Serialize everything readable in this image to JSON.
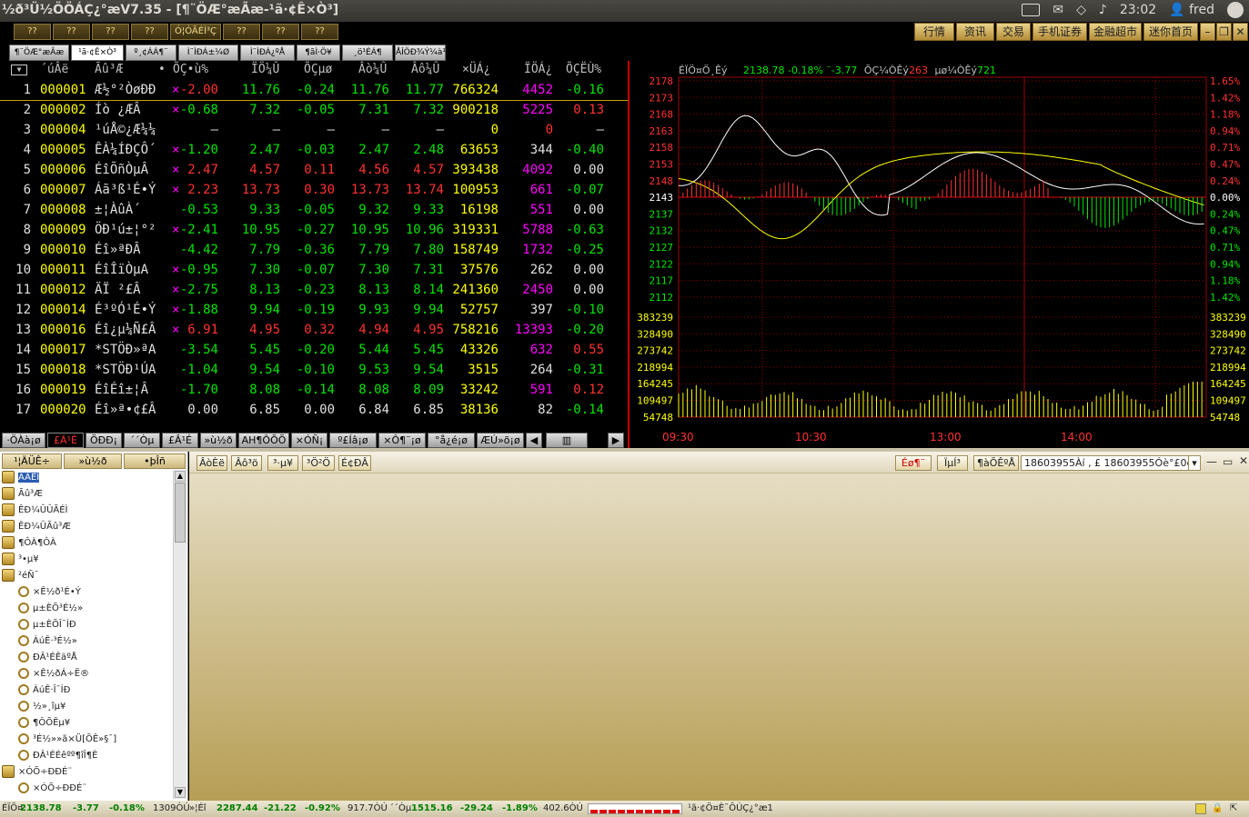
{
  "window": {
    "title": "½ð³Ü½ÖÖÁÇ¿°æV7.35 - [¶¨ÖÆ°æÃæ-¹ã·¢Ê×Ò³]",
    "time": "23:02",
    "user": "fred"
  },
  "top_buttons": [
    "??",
    "??",
    "??",
    "??",
    "Ó¦ÓÃÉÌ³Ç",
    "??",
    "??",
    "??"
  ],
  "right_buttons": [
    "行情",
    "资讯",
    "交易",
    "手机证券",
    "金融超市",
    "迷你首页"
  ],
  "tabs": [
    "¶¨ÖÆ°æÃæ",
    "¹ã·¢Ê×Ò³",
    "º¸¢ÁÁ¶¨",
    "Ì¨ÌÐÁ±¼Ø",
    "Ì¨ÌÐÁ¿ºÅ",
    "¶ãÌ·Ö¥",
    "¸ö¹ÉÁ¶",
    "ÅÎÖÐ¾Ý¼à¹Ü"
  ],
  "grid": {
    "headers": [
      "´úÂë",
      "Ãû³Æ",
      "•",
      "ÕÇ•ù%",
      "ÏÖ¼Û",
      "ÕÇµø",
      "Âò¼Û",
      "Âô¼Û",
      "×ÜÁ¿",
      "ÏÖÁ¿",
      "ÕÇËÙ%"
    ],
    "rows": [
      {
        "n": "1",
        "code": "000001",
        "name": "Æ½°²ÒøÐÐ",
        "mark": "×",
        "pct": "-2.00",
        "price": "11.76",
        "chg": "-0.24",
        "buy": "11.76",
        "sell": "11.77",
        "vol": "766324",
        "cur": "4452",
        "speed": "-0.16",
        "pc": "red",
        "cc": "purple",
        "sc": "green",
        "prc": "green"
      },
      {
        "n": "2",
        "code": "000002",
        "name": "Íò ¿ÆÂ",
        "mark": "×",
        "pct": "-0.68",
        "price": "7.32",
        "chg": "-0.05",
        "buy": "7.31",
        "sell": "7.32",
        "vol": "900218",
        "cur": "5225",
        "speed": "0.13",
        "pc": "green",
        "cc": "purple",
        "sc": "red",
        "prc": "green"
      },
      {
        "n": "3",
        "code": "000004",
        "name": "¹úÅ©¿Æ¼¼",
        "mark": "",
        "pct": "—",
        "price": "—",
        "chg": "—",
        "buy": "—",
        "sell": "—",
        "vol": "0",
        "cur": "0",
        "speed": "—",
        "pc": "white",
        "cc": "red",
        "sc": "white",
        "prc": "white"
      },
      {
        "n": "4",
        "code": "000005",
        "name": "ÊÀ¼ÍÐÇÔ´",
        "mark": "×",
        "pct": "-1.20",
        "price": "2.47",
        "chg": "-0.03",
        "buy": "2.47",
        "sell": "2.48",
        "vol": "63653",
        "cur": "344",
        "speed": "-0.40",
        "pc": "green",
        "cc": "white",
        "sc": "green",
        "prc": "green"
      },
      {
        "n": "5",
        "code": "000006",
        "name": "ÉîÕñÒµÂ",
        "mark": "×",
        "pct": "2.47",
        "price": "4.57",
        "chg": "0.11",
        "buy": "4.56",
        "sell": "4.57",
        "vol": "393438",
        "cur": "4092",
        "speed": "0.00",
        "pc": "red",
        "cc": "purple",
        "sc": "white",
        "prc": "red"
      },
      {
        "n": "6",
        "code": "000007",
        "name": "Áã³ß¹É•Ý",
        "mark": "×",
        "pct": "2.23",
        "price": "13.73",
        "chg": "0.30",
        "buy": "13.73",
        "sell": "13.74",
        "vol": "100953",
        "cur": "661",
        "speed": "-0.07",
        "pc": "red",
        "cc": "purple",
        "sc": "green",
        "prc": "red"
      },
      {
        "n": "7",
        "code": "000008",
        "name": "±¦ÀûÀ´",
        "mark": "",
        "pct": "-0.53",
        "price": "9.33",
        "chg": "-0.05",
        "buy": "9.32",
        "sell": "9.33",
        "vol": "16198",
        "cur": "551",
        "speed": "0.00",
        "pc": "green",
        "cc": "purple",
        "sc": "white",
        "prc": "green"
      },
      {
        "n": "8",
        "code": "000009",
        "name": "ÖÐ¹ú±¦°²",
        "mark": "×",
        "pct": "-2.41",
        "price": "10.95",
        "chg": "-0.27",
        "buy": "10.95",
        "sell": "10.96",
        "vol": "319331",
        "cur": "5788",
        "speed": "-0.63",
        "pc": "green",
        "cc": "purple",
        "sc": "green",
        "prc": "green"
      },
      {
        "n": "9",
        "code": "000010",
        "name": "Éî»ªÐÂ",
        "mark": "",
        "pct": "-4.42",
        "price": "7.79",
        "chg": "-0.36",
        "buy": "7.79",
        "sell": "7.80",
        "vol": "158749",
        "cur": "1732",
        "speed": "-0.25",
        "pc": "green",
        "cc": "purple",
        "sc": "green",
        "prc": "green"
      },
      {
        "n": "10",
        "code": "000011",
        "name": "ÉîÎïÒµA",
        "mark": "×",
        "pct": "-0.95",
        "price": "7.30",
        "chg": "-0.07",
        "buy": "7.30",
        "sell": "7.31",
        "vol": "37576",
        "cur": "262",
        "speed": "0.00",
        "pc": "green",
        "cc": "white",
        "sc": "white",
        "prc": "green"
      },
      {
        "n": "11",
        "code": "000012",
        "name": "ÄÏ ²£Â",
        "mark": "×",
        "pct": "-2.75",
        "price": "8.13",
        "chg": "-0.23",
        "buy": "8.13",
        "sell": "8.14",
        "vol": "241360",
        "cur": "2450",
        "speed": "0.00",
        "pc": "green",
        "cc": "purple",
        "sc": "white",
        "prc": "green"
      },
      {
        "n": "12",
        "code": "000014",
        "name": "É³ºÓ¹É•Ý",
        "mark": "×",
        "pct": "-1.88",
        "price": "9.94",
        "chg": "-0.19",
        "buy": "9.93",
        "sell": "9.94",
        "vol": "52757",
        "cur": "397",
        "speed": "-0.10",
        "pc": "green",
        "cc": "white",
        "sc": "green",
        "prc": "green"
      },
      {
        "n": "13",
        "code": "000016",
        "name": "Éî¿µ¼Ñ£Â",
        "mark": "×",
        "pct": "6.91",
        "price": "4.95",
        "chg": "0.32",
        "buy": "4.94",
        "sell": "4.95",
        "vol": "758216",
        "cur": "13393",
        "speed": "-0.20",
        "pc": "red",
        "cc": "purple",
        "sc": "green",
        "prc": "red"
      },
      {
        "n": "14",
        "code": "000017",
        "name": "*STÖÐ»ªA",
        "mark": "",
        "pct": "-3.54",
        "price": "5.45",
        "chg": "-0.20",
        "buy": "5.44",
        "sell": "5.45",
        "vol": "43326",
        "cur": "632",
        "speed": "0.55",
        "pc": "green",
        "cc": "purple",
        "sc": "red",
        "prc": "green"
      },
      {
        "n": "15",
        "code": "000018",
        "name": "*STÖÐ¹ÚA",
        "mark": "",
        "pct": "-1.04",
        "price": "9.54",
        "chg": "-0.10",
        "buy": "9.53",
        "sell": "9.54",
        "vol": "3515",
        "cur": "264",
        "speed": "-0.31",
        "pc": "green",
        "cc": "white",
        "sc": "green",
        "prc": "green"
      },
      {
        "n": "16",
        "code": "000019",
        "name": "ÉîÉî±¦Â",
        "mark": "",
        "pct": "-1.70",
        "price": "8.08",
        "chg": "-0.14",
        "buy": "8.08",
        "sell": "8.09",
        "vol": "33242",
        "cur": "591",
        "speed": "0.12",
        "pc": "green",
        "cc": "purple",
        "sc": "red",
        "prc": "green"
      },
      {
        "n": "17",
        "code": "000020",
        "name": "Éî»ª•¢£Â",
        "mark": "",
        "pct": "0.00",
        "price": "6.85",
        "chg": "0.00",
        "buy": "6.84",
        "sell": "6.85",
        "vol": "38136",
        "cur": "82",
        "speed": "-0.14",
        "pc": "white",
        "cc": "white",
        "sc": "green",
        "prc": "white"
      }
    ]
  },
  "sheet_tabs": [
    "·ÖÀà¡ø",
    "£Á¹É",
    "ÖÐÐ¡",
    "´´Òµ",
    "£Â¹É",
    "»ù½ð",
    "AH¶ÔÕÕ",
    "×ÓÑ¡",
    "º£Íâ¡ø",
    "×Ô¶¨¡ø",
    "°å¿é¡ø",
    "ÆÚ»õ¡ø"
  ],
  "chart": {
    "header_name": "ÉÏÖ¤Ö¸Êý",
    "header_value": "2138.78",
    "header_pct": "-0.18%",
    "header_chg": "¨-3.77",
    "up_label": "ÕÇ¼ÒÊý",
    "up_count": "263",
    "down_label": "µø¼ÒÊý",
    "down_count": "721",
    "price_ticks": [
      "2178",
      "2173",
      "2168",
      "2163",
      "2158",
      "2153",
      "2148",
      "2143",
      "2137",
      "2132",
      "2127",
      "2122",
      "2117",
      "2112"
    ],
    "pct_ticks": [
      "1.65%",
      "1.42%",
      "1.18%",
      "0.94%",
      "0.71%",
      "0.47%",
      "0.24%",
      "0.00%",
      "0.24%",
      "0.47%",
      "0.71%",
      "0.94%",
      "1.18%",
      "1.42%"
    ],
    "vol_ticks": [
      "383239",
      "328490",
      "273742",
      "218994",
      "164245",
      "109497",
      "54748"
    ],
    "time_ticks": [
      "09:30",
      "10:30",
      "13:00",
      "14:00"
    ],
    "colors": {
      "up": "#ff3232",
      "down": "#00e600",
      "price_line": "#ffffff",
      "avg_line": "#ffff00",
      "grid": "#a00000",
      "axis_red": "#ff3232"
    }
  },
  "left_panel": {
    "tabs": [
      "¹¦ÄÜÊ÷",
      "»ù½ð",
      "•þÎñ"
    ],
    "items": [
      {
        "label": "ÃÀÉÌ",
        "type": "folder",
        "selected": true
      },
      {
        "label": "Ãû³Æ",
        "type": "folder"
      },
      {
        "label": "ÊÐ¼ÛÛÃÉÌ",
        "type": "folder"
      },
      {
        "label": "ÊÐ¼ÛÃû³Æ",
        "type": "folder"
      },
      {
        "label": "¶ÔÀ¶ÔÀ",
        "type": "folder"
      },
      {
        "label": "³•µ¥",
        "type": "folder"
      },
      {
        "label": "²éÑ¯",
        "type": "folder"
      },
      {
        "label": "×Ê½ð¹É•Ý",
        "type": "query"
      },
      {
        "label": "µ±ÈÕ³É½»",
        "type": "query"
      },
      {
        "label": "µ±ÈÕÎ¯ÍÐ",
        "type": "query"
      },
      {
        "label": "ÀúÊ·³É½»",
        "type": "query"
      },
      {
        "label": "ÐÂ¹ÉÊäºÅ",
        "type": "query"
      },
      {
        "label": "×Ê½ðÁ÷Ë®",
        "type": "query"
      },
      {
        "label": "ÀúÊ·Î¯ÍÐ",
        "type": "query"
      },
      {
        "label": "½»¸îµ¥",
        "type": "query"
      },
      {
        "label": "¶ÔÕÊµ¥",
        "type": "query"
      },
      {
        "label": "³É½»»ã×Ü[ÕÊ»§¯]",
        "type": "query"
      },
      {
        "label": "ÐÂ¹ÉÉêºº¶îÎ¶È",
        "type": "query"
      },
      {
        "label": "×ÓÕ÷ÐÐÉ¨",
        "type": "folder"
      },
      {
        "label": "×ÓÕ÷ÐÐÉ¨",
        "type": "query"
      }
    ]
  },
  "main_toolbar": {
    "left": [
      "ÂòÈë",
      "Âô³ö",
      "³·µ¥",
      "³Ö²Ö",
      "É¢ÐÂ"
    ],
    "right": [
      "Éø¶¨",
      "ÏµÍ³",
      "¶àÕÊºÅ"
    ],
    "account": "18603955Àí , £ 18603955Óè°£0ëèÕ"
  },
  "statusbar": {
    "sh_label": "ÉÏÖ¤",
    "sh_value": "2138.78",
    "sh_chg": "-3.77",
    "sh_pct": "-0.18%",
    "sh_amt": "1309ÒÚ",
    "sz_label": "»¦Éî",
    "sz_value": "2287.44",
    "sz_chg": "-21.22",
    "sz_pct": "-0.92%",
    "sz_amt": "917.7ÒÚ",
    "cy_label": "´´Òµ",
    "cy_value": "1515.16",
    "cy_chg": "-29.24",
    "cy_pct": "-1.89%",
    "cy_amt": "402.6ÒÚ",
    "broker": "¹ã·¢Ö¤È¯ÔÚÇ¿°æ1"
  }
}
